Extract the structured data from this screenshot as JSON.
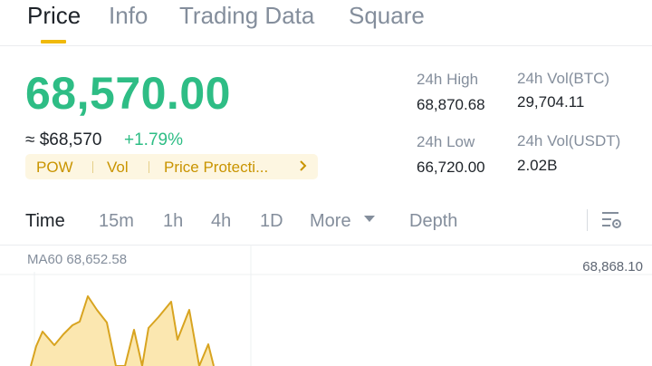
{
  "tabs": [
    {
      "label": "Price",
      "active": true
    },
    {
      "label": "Info",
      "active": false
    },
    {
      "label": "Trading Data",
      "active": false
    },
    {
      "label": "Square",
      "active": false
    }
  ],
  "price": {
    "last": "68,570.00",
    "approx_usd": "≈ $68,570",
    "change_pct": "+1.79%"
  },
  "tags": [
    "POW",
    "Vol",
    "Price Protecti..."
  ],
  "stats": {
    "high_label": "24h High",
    "high_value": "68,870.68",
    "low_label": "24h Low",
    "low_value": "66,720.00",
    "vol_btc_label": "24h Vol(BTC)",
    "vol_btc_value": "29,704.11",
    "vol_usdt_label": "24h Vol(USDT)",
    "vol_usdt_value": "2.02B"
  },
  "timeframes": [
    {
      "label": "Time",
      "active": true
    },
    {
      "label": "15m",
      "active": false
    },
    {
      "label": "1h",
      "active": false
    },
    {
      "label": "4h",
      "active": false
    },
    {
      "label": "1D",
      "active": false
    },
    {
      "label": "More",
      "active": false
    },
    {
      "label": "Depth",
      "active": false
    }
  ],
  "chart": {
    "ma_label": "MA60 68,652.58",
    "high_marker": "68,868.10"
  },
  "colors": {
    "up": "#2ebd85",
    "accent": "#f0b90b",
    "area_fill": "#fbe7b0",
    "area_line": "#d8a420"
  },
  "icons": {
    "settings": "chart-settings-icon",
    "tag_more": "chevron-right-icon",
    "more_dropdown": "caret-down-icon"
  }
}
